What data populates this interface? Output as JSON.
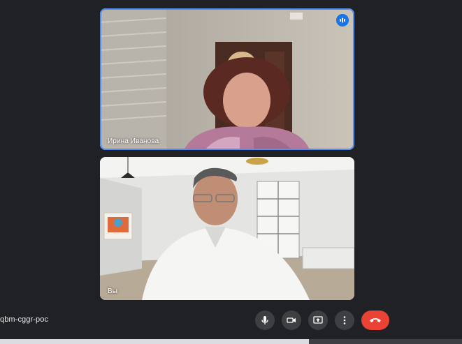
{
  "participants": [
    {
      "name": "Ирина Иванова",
      "speaking": true
    },
    {
      "name": "Вы",
      "speaking": false
    }
  ],
  "meeting": {
    "code": "qbm-cggr-poc"
  },
  "controls": {
    "icons": [
      "microphone-icon",
      "camera-icon",
      "present-screen-icon",
      "more-options-icon",
      "end-call-icon"
    ],
    "end_call_color": "#ea4335",
    "active_speaker_color": "#4f8df5"
  }
}
